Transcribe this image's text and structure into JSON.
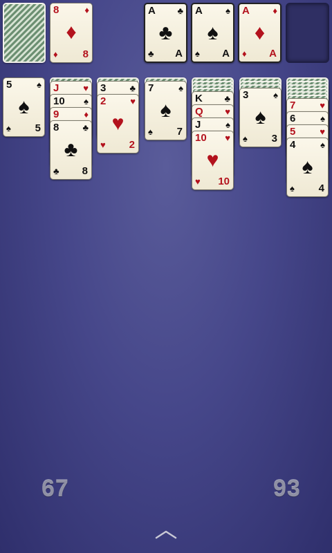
{
  "stock": {
    "icon": "card-back"
  },
  "waste": {
    "rank": "8",
    "suit": "♦",
    "color": "red"
  },
  "foundations": [
    {
      "rank": "A",
      "suit": "♣",
      "color": "black"
    },
    {
      "rank": "A",
      "suit": "♠",
      "color": "black"
    },
    {
      "rank": "A",
      "suit": "♦",
      "color": "red"
    }
  ],
  "tableau": [
    {
      "hidden": 0,
      "cards": [
        {
          "rank": "5",
          "suit": "♠",
          "color": "black"
        }
      ]
    },
    {
      "hidden": 1,
      "cards": [
        {
          "rank": "J",
          "suit": "♥",
          "color": "red"
        },
        {
          "rank": "10",
          "suit": "♠",
          "color": "black"
        },
        {
          "rank": "9",
          "suit": "♦",
          "color": "red"
        },
        {
          "rank": "8",
          "suit": "♣",
          "color": "black"
        }
      ]
    },
    {
      "hidden": 1,
      "cards": [
        {
          "rank": "3",
          "suit": "♣",
          "color": "black"
        },
        {
          "rank": "2",
          "suit": "♥",
          "color": "red"
        }
      ]
    },
    {
      "hidden": 1,
      "cards": [
        {
          "rank": "7",
          "suit": "♠",
          "color": "black"
        }
      ]
    },
    {
      "hidden": 4,
      "cards": [
        {
          "rank": "K",
          "suit": "♣",
          "color": "black"
        },
        {
          "rank": "Q",
          "suit": "♥",
          "color": "red"
        },
        {
          "rank": "J",
          "suit": "♠",
          "color": "black"
        },
        {
          "rank": "10",
          "suit": "♥",
          "color": "red"
        }
      ]
    },
    {
      "hidden": 3,
      "cards": [
        {
          "rank": "3",
          "suit": "♠",
          "color": "black"
        }
      ]
    },
    {
      "hidden": 6,
      "cards": [
        {
          "rank": "7",
          "suit": "♥",
          "color": "red"
        },
        {
          "rank": "6",
          "suit": "♠",
          "color": "black"
        },
        {
          "rank": "5",
          "suit": "♥",
          "color": "red"
        },
        {
          "rank": "4",
          "suit": "♠",
          "color": "black"
        }
      ]
    }
  ],
  "scores": {
    "left": "67",
    "right": "93"
  },
  "menu": {
    "icon": "chevron-up-icon"
  },
  "colors": {
    "red": "#b3121d",
    "black": "#111111",
    "table": "#46478a"
  }
}
